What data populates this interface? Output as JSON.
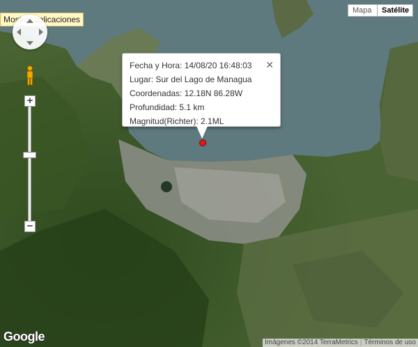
{
  "tooltip": {
    "text": "Mostrar aplicaciones"
  },
  "map_type": {
    "map_label": "Mapa",
    "satellite_label": "Satélite",
    "active": "Satélite"
  },
  "zoom": {
    "in_symbol": "+",
    "out_symbol": "−"
  },
  "info_window": {
    "lines": [
      "Fecha y Hora: 14/08/20 16:48:03",
      "Lugar: Sur del Lago de Managua",
      "Coordenadas: 12.18N 86.28W",
      "Profundidad: 5.1 km",
      "Magnitud(Richter): 2.1ML"
    ],
    "close_symbol": "✕"
  },
  "marker": {
    "color": "#e0191a"
  },
  "logo": {
    "text": "Google"
  },
  "attribution": {
    "imagery": "Imágenes ©2014 TerraMetrics",
    "terms": "Términos de uso"
  },
  "colors": {
    "lake": "#5f7b80",
    "land": "#3f5a2a",
    "urban": "#9a9a92"
  }
}
